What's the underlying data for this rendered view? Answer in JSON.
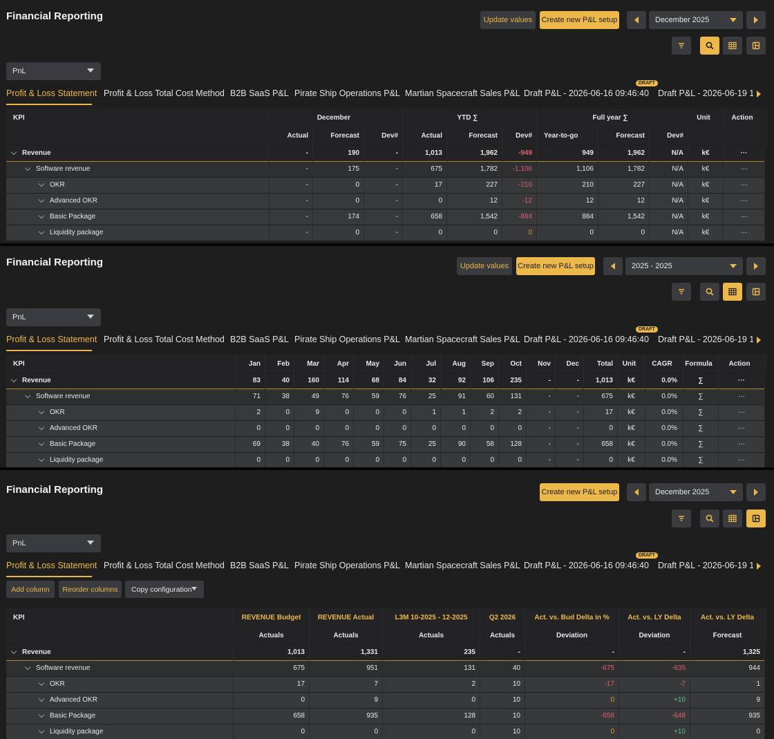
{
  "colors": {
    "accent": "#ecb849",
    "negative": "#e05e6d",
    "positive": "#55c08a",
    "background": "#1e1e1f"
  },
  "app": {
    "title": "Financial Reporting"
  },
  "buttons": {
    "update_values": "Update values",
    "create_pl": "Create new P&L setup",
    "add_column": "Add column",
    "reorder_columns": "Reorder columns",
    "copy_configuration": "Copy configuration"
  },
  "icons": [
    "filter-icon",
    "search-icon",
    "table-icon",
    "columns-icon",
    "chevron-left-icon",
    "chevron-right-icon",
    "chevron-down-icon"
  ],
  "report_select": {
    "value": "PnL"
  },
  "tabs": [
    {
      "label": "Profit & Loss Statement"
    },
    {
      "label": "Profit & Loss Total Cost Method"
    },
    {
      "label": "B2B SaaS P&L"
    },
    {
      "label": "Pirate Ship Operations P&L"
    },
    {
      "label": "Martian Spacecraft Sales P&L"
    },
    {
      "label": "Draft P&L - 2026-06-16 09:46:40",
      "badge": "DRAFT"
    },
    {
      "label": "Draft P&L - 2026-06-19 1"
    }
  ],
  "panel1": {
    "period": "December 2025",
    "groups": {
      "kpi": "KPI",
      "month": "December",
      "ytd": "YTD ∑",
      "full_year": "Full year ∑",
      "unit": "Unit",
      "action": "Action"
    },
    "subheaders": [
      "Actual",
      "Forecast",
      "Dev#",
      "Actual",
      "Forecast",
      "Dev#",
      "Year-to-go",
      "Forecast",
      "Dev#"
    ],
    "rows": [
      {
        "kpi": "Revenue",
        "cells": [
          "-",
          "190",
          "-",
          "1,013",
          "1,962",
          "-949",
          "949",
          "1,962",
          "N/A",
          "k€",
          "···"
        ]
      },
      {
        "kpi": "Software revenue",
        "cells": [
          "-",
          "175",
          "-",
          "675",
          "1,782",
          "-1,106",
          "1,106",
          "1,782",
          "N/A",
          "k€",
          "···"
        ]
      },
      {
        "kpi": "OKR",
        "cells": [
          "-",
          "0",
          "-",
          "17",
          "227",
          "-210",
          "210",
          "227",
          "N/A",
          "k€",
          "···"
        ]
      },
      {
        "kpi": "Advanced OKR",
        "cells": [
          "-",
          "0",
          "-",
          "0",
          "12",
          "-12",
          "12",
          "12",
          "N/A",
          "k€",
          "···"
        ]
      },
      {
        "kpi": "Basic Package",
        "cells": [
          "-",
          "174",
          "-",
          "658",
          "1,542",
          "-884",
          "884",
          "1,542",
          "N/A",
          "k€",
          "···"
        ]
      },
      {
        "kpi": "Liquidity package",
        "cells": [
          "-",
          "0",
          "-",
          "0",
          "0",
          "0",
          "0",
          "0",
          "N/A",
          "k€",
          "···"
        ]
      }
    ]
  },
  "panel2": {
    "period": "2025 - 2025",
    "headers": [
      "KPI",
      "Jan",
      "Feb",
      "Mar",
      "Apr",
      "May",
      "Jun",
      "Jul",
      "Aug",
      "Sep",
      "Oct",
      "Nov",
      "Dec",
      "Total",
      "Unit",
      "CAGR",
      "Formula",
      "Action"
    ],
    "rows": [
      {
        "kpi": "Revenue",
        "cells": [
          "83",
          "40",
          "160",
          "114",
          "68",
          "84",
          "32",
          "92",
          "106",
          "235",
          "-",
          "-",
          "1,013",
          "k€",
          "0.0%",
          "∑",
          "···"
        ]
      },
      {
        "kpi": "Software revenue",
        "cells": [
          "71",
          "38",
          "49",
          "76",
          "59",
          "76",
          "25",
          "91",
          "60",
          "131",
          "-",
          "-",
          "675",
          "k€",
          "0.0%",
          "∑",
          "···"
        ]
      },
      {
        "kpi": "OKR",
        "cells": [
          "2",
          "0",
          "9",
          "0",
          "0",
          "0",
          "1",
          "1",
          "2",
          "2",
          "-",
          "-",
          "17",
          "k€",
          "0.0%",
          "∑",
          "···"
        ]
      },
      {
        "kpi": "Advanced OKR",
        "cells": [
          "0",
          "0",
          "0",
          "0",
          "0",
          "0",
          "0",
          "0",
          "0",
          "0",
          "-",
          "-",
          "0",
          "k€",
          "0.0%",
          "∑",
          "···"
        ]
      },
      {
        "kpi": "Basic Package",
        "cells": [
          "69",
          "38",
          "40",
          "76",
          "59",
          "75",
          "25",
          "90",
          "58",
          "128",
          "-",
          "-",
          "658",
          "k€",
          "0.0%",
          "∑",
          "···"
        ]
      },
      {
        "kpi": "Liquidity package",
        "cells": [
          "0",
          "0",
          "0",
          "0",
          "0",
          "0",
          "0",
          "0",
          "0",
          "0",
          "-",
          "-",
          "0",
          "k€",
          "0.0%",
          "∑",
          "···"
        ]
      }
    ]
  },
  "panel3": {
    "period": "December 2025",
    "headers": [
      "KPI",
      "REVENUE Budget",
      "REVENUE Actual",
      "L3M 10-2025 - 12-2025",
      "Q2 2026",
      "Act. vs. Bud Delta in %",
      "Act. vs. LY Delta",
      "Act. vs. LY Delta"
    ],
    "subheaders": [
      "",
      "Actuals",
      "Actuals",
      "Actuals",
      "Actuals",
      "Deviation",
      "Deviation",
      "Forecast"
    ],
    "rows": [
      {
        "kpi": "Revenue",
        "cells": [
          "1,013",
          "1,331",
          "235",
          "-",
          "-",
          "-",
          "1,325"
        ]
      },
      {
        "kpi": "Software revenue",
        "cells": [
          "675",
          "951",
          "131",
          "40",
          "-675",
          "-635",
          "944"
        ]
      },
      {
        "kpi": "OKR",
        "cells": [
          "17",
          "7",
          "2",
          "10",
          "-17",
          "-7",
          "1"
        ]
      },
      {
        "kpi": "Advanced OKR",
        "cells": [
          "0",
          "9",
          "0",
          "10",
          "0",
          "+10",
          "9"
        ]
      },
      {
        "kpi": "Basic Package",
        "cells": [
          "658",
          "935",
          "128",
          "10",
          "-658",
          "-648",
          "935"
        ]
      },
      {
        "kpi": "Liquidity package",
        "cells": [
          "0",
          "0",
          "0",
          "10",
          "0",
          "+10",
          "0"
        ]
      }
    ]
  }
}
